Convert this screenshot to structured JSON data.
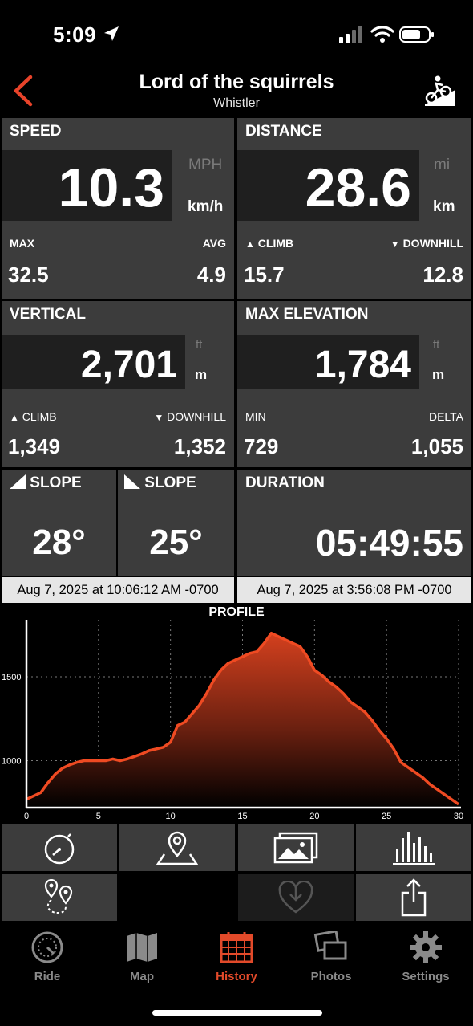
{
  "status_bar": {
    "time": "5:09"
  },
  "header": {
    "title": "Lord of the squirrels",
    "subtitle": "Whistler"
  },
  "speed": {
    "title": "SPEED",
    "value": "10.3",
    "unit_alt": "MPH",
    "unit": "km/h",
    "max_label": "MAX",
    "avg_label": "AVG",
    "max": "32.5",
    "avg": "4.9"
  },
  "distance": {
    "title": "DISTANCE",
    "value": "28.6",
    "unit_alt": "mi",
    "unit": "km",
    "climb_label": "CLIMB",
    "downhill_label": "DOWNHILL",
    "climb": "15.7",
    "downhill": "12.8"
  },
  "vertical": {
    "title": "VERTICAL",
    "value": "2,701",
    "unit_alt": "ft",
    "unit": "m",
    "climb_label": "CLIMB",
    "downhill_label": "DOWNHILL",
    "climb": "1,349",
    "downhill": "1,352"
  },
  "max_elevation": {
    "title": "MAX ELEVATION",
    "value": "1,784",
    "unit_alt": "ft",
    "unit": "m",
    "min_label": "MIN",
    "delta_label": "DELTA",
    "min": "729",
    "delta": "1,055"
  },
  "slope_up": {
    "title": "SLOPE",
    "value": "28°"
  },
  "slope_down": {
    "title": "SLOPE",
    "value": "25°"
  },
  "duration": {
    "title": "DURATION",
    "value": "05:49:55"
  },
  "dates": {
    "start": "Aug 7, 2025 at 10:06:12 AM -0700",
    "end": "Aug 7, 2025 at 3:56:08 PM -0700"
  },
  "profile": {
    "title": "PROFILE",
    "accent": "#ef4a22"
  },
  "chart_data": {
    "type": "area",
    "title": "PROFILE",
    "xlabel": "",
    "ylabel": "",
    "xlim": [
      0,
      30
    ],
    "ylim": [
      720,
      1840
    ],
    "x_ticks": [
      0,
      5,
      10,
      15,
      20,
      25,
      30
    ],
    "y_ticks": [
      1000,
      1500
    ],
    "grid": true,
    "series": [
      {
        "x": [
          0,
          0.5,
          1,
          1.5,
          2,
          2.5,
          3,
          3.5,
          4,
          4.5,
          5,
          5.5,
          6,
          6.5,
          7,
          7.5,
          8,
          8.5,
          9,
          9.5,
          10,
          10.5,
          11,
          11.5,
          12,
          12.5,
          13,
          13.5,
          14,
          14.5,
          15,
          15.5,
          16,
          16.5,
          17,
          17.5,
          18,
          18.5,
          19,
          19.5,
          20,
          20.5,
          21,
          21.5,
          22,
          22.5,
          23,
          23.5,
          24,
          24.5,
          25,
          25.5,
          26,
          26.5,
          27,
          27.5,
          28,
          28.5,
          29,
          29.5,
          30
        ],
        "y": [
          770,
          790,
          810,
          870,
          920,
          955,
          975,
          990,
          1000,
          1000,
          1000,
          1000,
          1010,
          1000,
          1010,
          1025,
          1040,
          1060,
          1070,
          1080,
          1110,
          1210,
          1230,
          1280,
          1330,
          1400,
          1480,
          1540,
          1580,
          1600,
          1620,
          1640,
          1650,
          1700,
          1760,
          1740,
          1720,
          1700,
          1680,
          1620,
          1540,
          1510,
          1470,
          1440,
          1400,
          1350,
          1320,
          1290,
          1240,
          1180,
          1130,
          1070,
          990,
          960,
          930,
          900,
          860,
          830,
          800,
          770,
          740
        ]
      }
    ]
  },
  "actions": [
    {
      "name": "stopwatch-icon"
    },
    {
      "name": "map-pin-icon"
    },
    {
      "name": "photos-icon"
    },
    {
      "name": "bar-chart-icon"
    },
    {
      "name": "route-icon"
    },
    {
      "name": "heart-download-icon"
    },
    {
      "name": "share-icon"
    }
  ],
  "tabs": [
    {
      "label": "Ride",
      "icon": "speedometer-icon"
    },
    {
      "label": "Map",
      "icon": "map-icon"
    },
    {
      "label": "History",
      "icon": "calendar-icon",
      "active": true
    },
    {
      "label": "Photos",
      "icon": "photos-icon"
    },
    {
      "label": "Settings",
      "icon": "gear-icon"
    }
  ]
}
